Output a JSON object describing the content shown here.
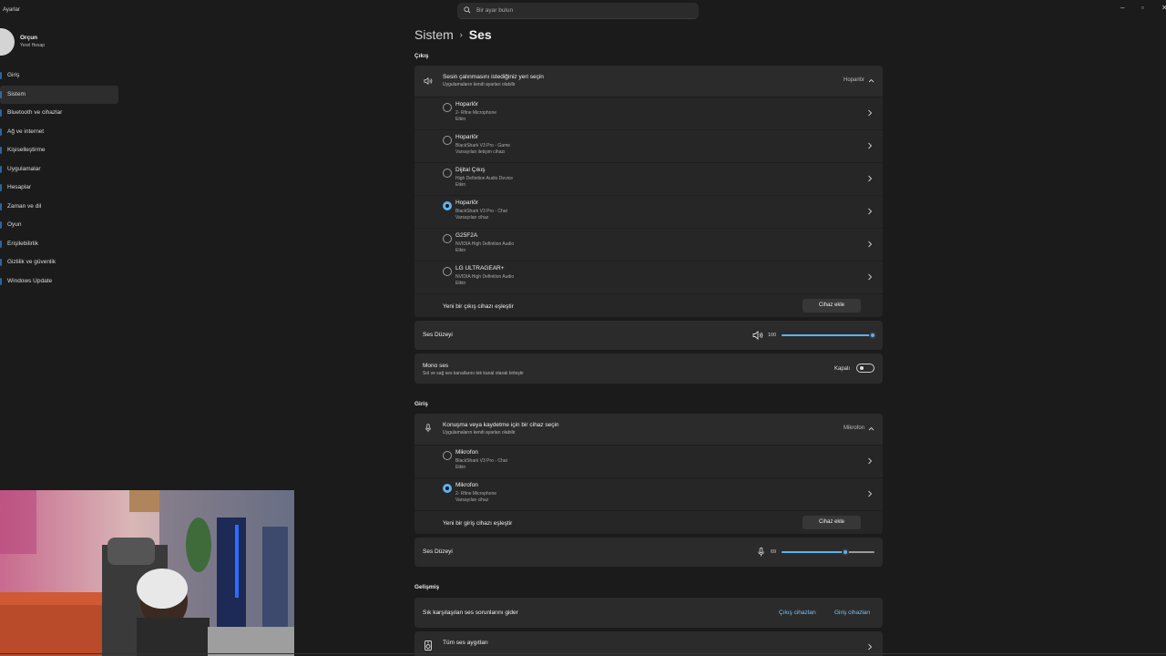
{
  "window": {
    "app_title": "Ayarlar",
    "minimize": "–",
    "maximize": "▫",
    "close": "✕"
  },
  "search": {
    "placeholder": "Bir ayar bulun"
  },
  "profile": {
    "name": "Orçun",
    "account_type": "Yerel Hesap"
  },
  "sidebar": {
    "items": [
      {
        "label": "Giriş",
        "active": false
      },
      {
        "label": "Sistem",
        "active": true
      },
      {
        "label": "Bluetooth ve cihazlar",
        "active": false
      },
      {
        "label": "Ağ ve internet",
        "active": false
      },
      {
        "label": "Kişiselleştirme",
        "active": false
      },
      {
        "label": "Uygulamalar",
        "active": false
      },
      {
        "label": "Hesaplar",
        "active": false
      },
      {
        "label": "Zaman ve dil",
        "active": false
      },
      {
        "label": "Oyun",
        "active": false
      },
      {
        "label": "Erişilebilirlik",
        "active": false
      },
      {
        "label": "Gizlilik ve güvenlik",
        "active": false
      },
      {
        "label": "Windows Update",
        "active": false
      }
    ]
  },
  "breadcrumb": {
    "root": "Sistem",
    "separator": "›",
    "page": "Ses"
  },
  "output": {
    "section_label": "Çıkış",
    "choose_title": "Sesin çalınmasını istediğiniz yeri seçin",
    "choose_subtitle": "Uygulamaların kendi ayarları olabilir",
    "selected_summary": "Hoparlör",
    "devices": [
      {
        "name": "Hoparlör",
        "description": "2- Rfine Microphone",
        "status": "Etkin",
        "selected": false
      },
      {
        "name": "Hoparlör",
        "description": "BlackShark V3 Pro - Game",
        "status": "Varsayılan iletişim cihazı",
        "selected": false
      },
      {
        "name": "Dijital Çıkış",
        "description": "High Definition Audio Device",
        "status": "Etkin",
        "selected": false
      },
      {
        "name": "Hoparlör",
        "description": "BlackShark V3 Pro - Chat",
        "status": "Varsayılan cihaz",
        "selected": true
      },
      {
        "name": "G25F2A",
        "description": "NVIDIA High Definition Audio",
        "status": "Etkin",
        "selected": false
      },
      {
        "name": "LG ULTRAGEAR+",
        "description": "NVIDIA High Definition Audio",
        "status": "Etkin",
        "selected": false
      }
    ],
    "pair_label": "Yeni bir çıkış cihazı eşleştir",
    "add_button": "Cihaz ekle",
    "volume_label": "Ses Düzeyi",
    "volume_value": "100",
    "volume_fraction": 1.0,
    "mono_title": "Mono ses",
    "mono_subtitle": "Sol ve sağ ses kanallarını tek kanal olarak birleştir",
    "mono_state": "Kapalı"
  },
  "input": {
    "section_label": "Giriş",
    "choose_title": "Konuşma veya kaydetme için bir cihaz seçin",
    "choose_subtitle": "Uygulamaların kendi ayarları olabilir",
    "selected_summary": "Mikrofon",
    "devices": [
      {
        "name": "Mikrofon",
        "description": "BlackShark V3 Pro - Chat",
        "status": "Etkin",
        "selected": false
      },
      {
        "name": "Mikrofon",
        "description": "2- Rfine Microphone",
        "status": "Varsayılan cihaz",
        "selected": true
      }
    ],
    "pair_label": "Yeni bir giriş cihazı eşleştir",
    "add_button": "Cihaz ekle",
    "volume_label": "Ses Düzeyi",
    "volume_value": "69",
    "volume_fraction": 0.69
  },
  "advanced": {
    "section_label": "Gelişmiş",
    "troubleshoot_label": "Sık karşılaşılan ses sorunlarını gider",
    "output_devices_link": "Çıkış cihazları",
    "input_devices_link": "Giriş cihazları",
    "all_devices_label": "Tüm ses aygıtları"
  },
  "colors": {
    "accent": "#5bb2f0",
    "background": "#1b1b1b",
    "card": "#2b2b2b",
    "card_sub": "#262626",
    "link": "#7bc2f5"
  }
}
